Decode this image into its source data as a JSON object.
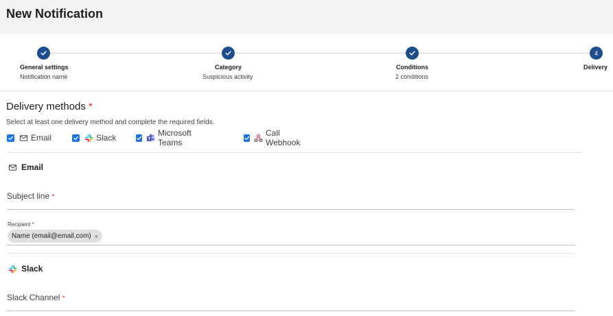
{
  "header": {
    "title": "New Notification"
  },
  "stepper": {
    "steps": [
      {
        "label": "General settings",
        "sub": "Notification name",
        "state": "done"
      },
      {
        "label": "Category",
        "sub": "Suspicious activity",
        "state": "done"
      },
      {
        "label": "Conditions",
        "sub": "2 conditions",
        "state": "done"
      },
      {
        "label": "Delivery",
        "sub": "",
        "state": "current",
        "number": "4"
      }
    ],
    "accent_color": "#1f4e8c"
  },
  "delivery": {
    "title": "Delivery methods",
    "required_mark": "*",
    "instructions": "Select at least one delivery method and complete the required fields.",
    "methods": [
      {
        "label": "Email",
        "checked": true,
        "icon": "mail-icon"
      },
      {
        "label": "Slack",
        "checked": true,
        "icon": "slack-icon"
      },
      {
        "label": "Microsoft Teams",
        "checked": true,
        "icon": "teams-icon"
      },
      {
        "label": "Call Webhook",
        "checked": true,
        "icon": "webhook-icon"
      }
    ],
    "checkbox_color": "#1a73e8"
  },
  "email_section": {
    "heading": "Email",
    "subject_label": "Subject line",
    "required_mark": "*",
    "recipient_label": "Recipient",
    "recipient_chip": "Name (email@email.com)",
    "chip_remove": "×"
  },
  "slack_section": {
    "heading": "Slack",
    "channel_label": "Slack Channel",
    "required_mark": "*"
  }
}
